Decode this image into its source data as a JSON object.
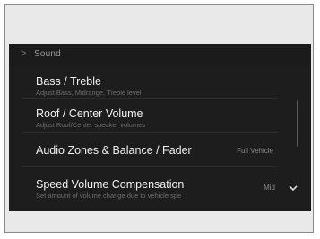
{
  "header": {
    "back_glyph": ">",
    "title": "Sound"
  },
  "items": [
    {
      "label": "Bass / Treble",
      "sub": "Adjust Bass, Midrange, Treble level"
    },
    {
      "label": "Roof / Center Volume",
      "sub": "Adjust Roof/Center speaker volumes"
    },
    {
      "label": "Audio Zones & Balance / Fader",
      "value": "Full Vehicle"
    },
    {
      "label": "Speed Volume Compensation",
      "sub": "Set amount of volume change due to vehicle spe",
      "value": "Mid"
    }
  ],
  "colors": {
    "screen_bg": "#1d1d1d",
    "frame_bg": "#e9e9e9",
    "text_primary": "#f2f2f2",
    "text_secondary": "#6f6f6f"
  },
  "icons": {
    "back": "chevron-right-icon",
    "more": "chevron-down-icon"
  }
}
